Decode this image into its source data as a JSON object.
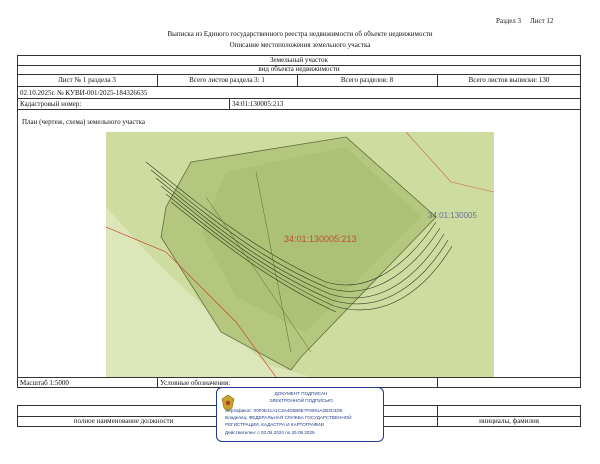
{
  "header": {
    "section_label": "Раздел 3",
    "sheet_label": "Лист 12",
    "title": "Выписка из Единого государственного реестра недвижимости об объекте недвижимости",
    "subtitle": "Описание местоположения земельного участка"
  },
  "object": {
    "name": "Земельный участок",
    "type_caption": "вид объекта недвижимости"
  },
  "sheet_info": {
    "sheet_of_section": "Лист № 1 раздела 3",
    "section_sheets": "Всего листов раздела 3: 1",
    "total_sections": "Всего разделов: 8",
    "total_sheets": "Всего листов выписки: 130"
  },
  "doc_ref": "02.10.2025г. № КУВИ-001/2025-184326635",
  "cadastral": {
    "label": "Кадастровый номер:",
    "value": "34:01:130005:213"
  },
  "plan": {
    "caption": "План (чертеж, схема) земельного участка",
    "label_main": "34:01:130005:213",
    "label_right": "34:01:130005",
    "colors": {
      "parcel": "#b5c77f",
      "background": "#dde6b8",
      "boundary": "#7a8a5a",
      "border_red": "#c0392b"
    }
  },
  "footer": {
    "scale_label": "Масштаб 1:5000",
    "legend_label": "Условные обозначения:",
    "position_caption": "полное наименование должности",
    "signature_caption": "подпись",
    "name_caption": "инициалы, фамилия"
  },
  "stamp": {
    "line1": "ДОКУМЕНТ ПОДПИСАН",
    "line2": "ЭЛЕКТРОННОЙ ПОДПИСЬЮ",
    "cert": "Сертификат: 00F0E41A1C3A4D5B6E7F8091A2B3C4D5",
    "owner_line1": "Владелец: ФЕДЕРАЛЬНАЯ СЛУЖБА ГОСУДАРСТВЕННОЙ",
    "owner_line2": "РЕГИСТРАЦИИ, КАДАСТРА И КАРТОГРАФИИ",
    "validity": "Действителен: с 02.06.2024 по 26.08.2025"
  }
}
